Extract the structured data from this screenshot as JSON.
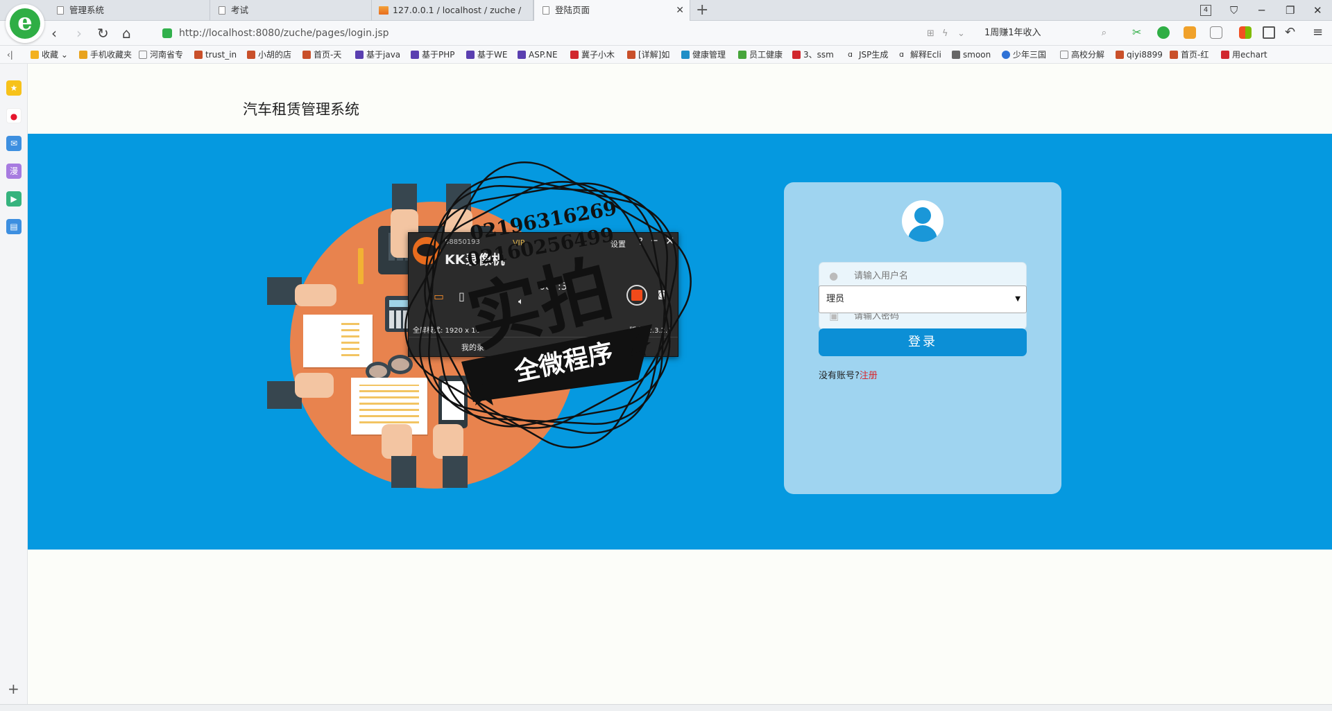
{
  "browser": {
    "tabs": [
      {
        "label": "管理系统"
      },
      {
        "label": "考试"
      },
      {
        "label": "127.0.0.1 / localhost / zuche /"
      },
      {
        "label": "登陆页面"
      }
    ],
    "tab_count": "4",
    "url_prefix": "http://localhost",
    "url_suffix": ":8080/zuche/pages/login.jsp",
    "search_text": "1周赚1年收入",
    "bookmarks": [
      "收藏",
      "手机收藏夹",
      "河南省专",
      "trust_in",
      "小胡的店",
      "首页-天",
      "基于java",
      "基于PHP",
      "基于WE",
      "ASP.NE",
      "冀子小木",
      "[详解]如",
      "健康管理",
      "员工健康",
      "3、ssm",
      "JSP生成",
      "解释Ecli",
      "smoon",
      "少年三国",
      "高校分解",
      "qiyi8899",
      "首页-红",
      "用echart"
    ]
  },
  "page": {
    "site_title": "汽车租赁管理系统",
    "login": {
      "username_placeholder": "请输入用户名",
      "password_placeholder": "请输入密码",
      "role_value": "理员",
      "login_button": "登录",
      "no_account_text": "没有账号?",
      "register_link": "注册"
    }
  },
  "overlay": {
    "kk_title": "KK录像机",
    "kk_account": "58850193",
    "kk_vip": "VIP",
    "kk_settings": "设置",
    "kk_help": "?",
    "kk_timer": "00:  :3",
    "kk_mode": "全屏模式: 1920 x 10",
    "kk_version": "版本: 2.3.2.6",
    "kk_my_recordings": "我的录",
    "stamp_phone1": "02196316269",
    "stamp_phone2": "02160256499",
    "stamp_big": "实拍",
    "stamp_banner": "全微程序"
  },
  "colors": {
    "hero_bg": "#0599e0",
    "card_bg": "#9fd4f0",
    "login_button": "#0c8fd6",
    "register_link": "#d9262c",
    "table_orange": "#e8834e"
  },
  "icons": {
    "sidebar": [
      "star-icon",
      "weibo-icon",
      "mail-icon",
      "comic-icon",
      "video-icon",
      "document-icon"
    ]
  }
}
